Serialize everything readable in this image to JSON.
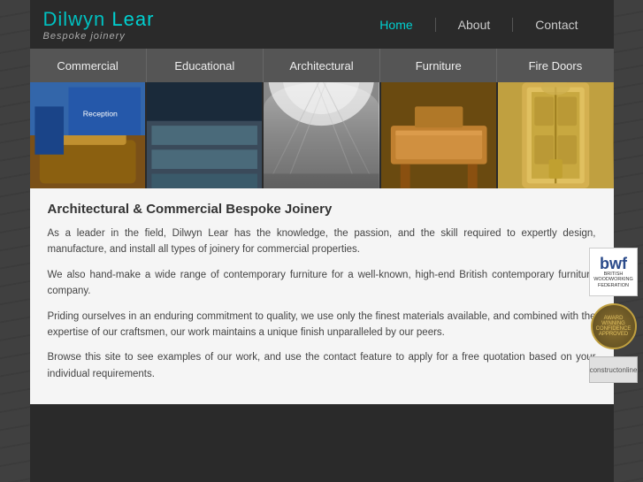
{
  "logo": {
    "title_normal": "Dilwyn ",
    "title_accent": "Lear",
    "subtitle": "Bespoke joinery"
  },
  "main_nav": {
    "items": [
      {
        "label": "Home",
        "active": true
      },
      {
        "label": "About",
        "active": false
      },
      {
        "label": "Contact",
        "active": false
      }
    ]
  },
  "sub_nav": {
    "items": [
      {
        "label": "Commercial"
      },
      {
        "label": "Educational"
      },
      {
        "label": "Architectural"
      },
      {
        "label": "Furniture"
      },
      {
        "label": "Fire Doors"
      }
    ]
  },
  "gallery": {
    "images": [
      {
        "alt": "Commercial interior"
      },
      {
        "alt": "Educational space"
      },
      {
        "alt": "Architectural ceiling"
      },
      {
        "alt": "Furniture piece"
      },
      {
        "alt": "Fire door"
      }
    ]
  },
  "content": {
    "title": "Architectural & Commercial Bespoke Joinery",
    "paragraphs": [
      "As a leader in the field, Dilwyn Lear has the knowledge, the passion, and the skill required to expertly design, manufacture, and install all types of joinery for commercial properties.",
      "We also hand-make a wide range of contemporary furniture for a well-known, high-end British contemporary furniture company.",
      "Priding ourselves in an enduring commitment to quality, we use only the finest materials available, and combined with the expertise of our craftsmen, our work maintains a unique finish unparalleled by our peers.",
      "Browse this site to see examples of our work, and use the contact feature to apply for a free quotation based on your individual requirements."
    ]
  },
  "sidebar": {
    "bwf": {
      "letters": "bwf",
      "line1": "BRITISH",
      "line2": "WOODWORKING",
      "line3": "FEDERATION"
    },
    "badge_text": "AWARD WINNING CONFIDENCE APPROVED",
    "construct_label": "constructonline"
  }
}
